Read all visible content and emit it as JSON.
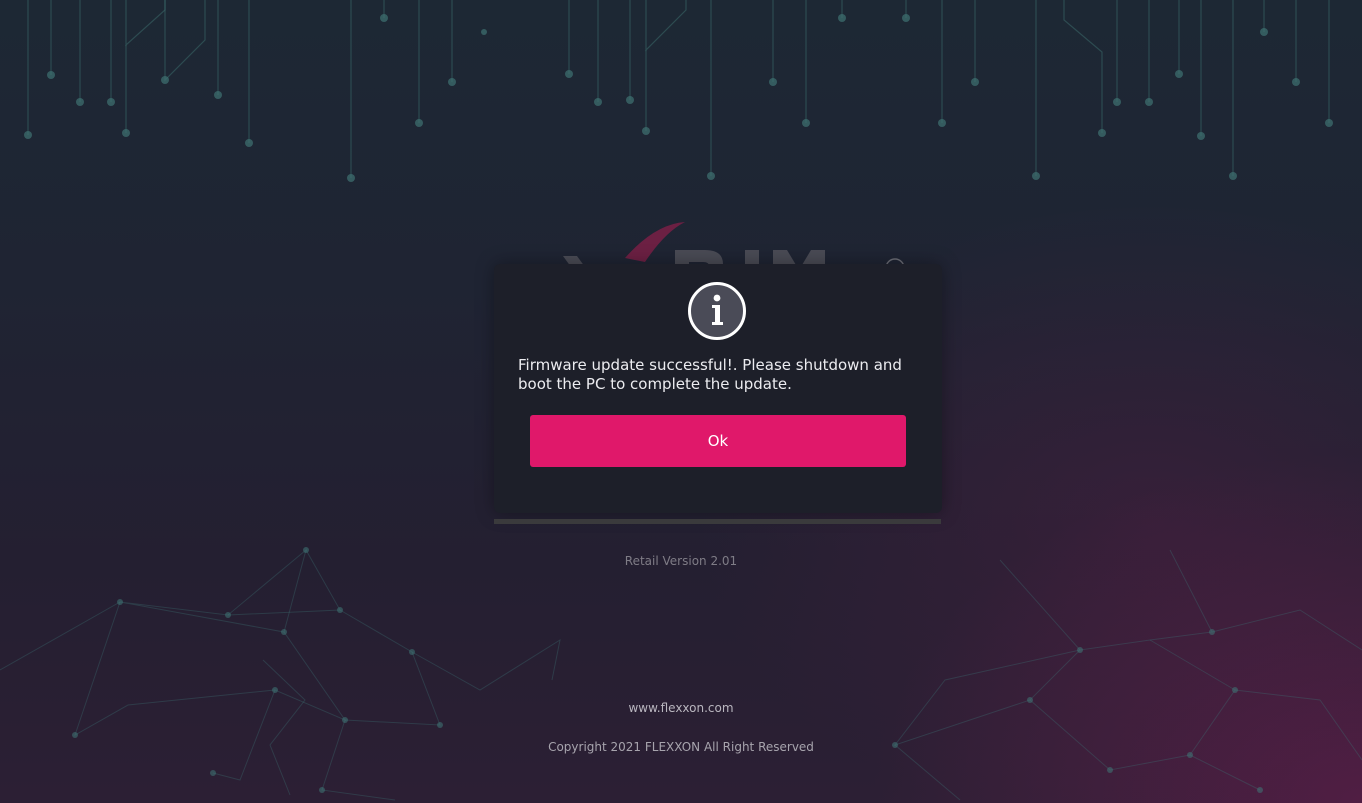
{
  "dialog": {
    "icon": "info-icon",
    "message": "Firmware update successful!. Please shutdown and boot the PC to complete the update.",
    "ok_label": "Ok"
  },
  "footer": {
    "version": "Retail Version 2.01",
    "website": "www.flexxon.com",
    "copyright": "Copyright 2021 FLEXXON All Right Reserved"
  },
  "colors": {
    "accent": "#e0186a",
    "dialog_bg": "#1d1f29",
    "background": "#1f2433"
  }
}
